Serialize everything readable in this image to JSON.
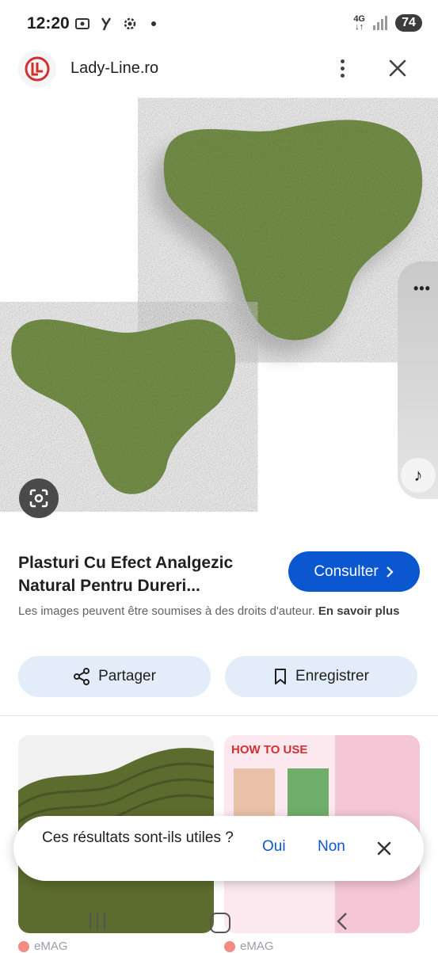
{
  "status_bar": {
    "time": "12:20",
    "network": "4G",
    "battery": "74",
    "icons": [
      "screenshot-icon",
      "y-app-icon",
      "settings-icon",
      "notification-dot-icon",
      "signal-icon"
    ]
  },
  "header": {
    "site_name": "Lady-Line.ro",
    "logo_icon": "lady-line-logo-icon",
    "menu_icon": "more-vert-icon",
    "close_icon": "close-icon"
  },
  "image": {
    "subject": "green-patch-product-image",
    "lens_icon": "google-lens-icon"
  },
  "edge_panel": {
    "dots_icon": "more-horiz-icon",
    "music_icon": "music-note-icon"
  },
  "result": {
    "title": "Plasturi Cu Efect Analgezic Natural Pentru Dureri...",
    "consult_label": "Consulter",
    "copyright_text": "Les images peuvent être soumises à des droits d'auteur.",
    "learn_more": "En savoir plus"
  },
  "actions": {
    "share_label": "Partager",
    "save_label": "Enregistrer"
  },
  "related": {
    "thumb2_banner": "HOW TO USE",
    "source1": "eMAG",
    "source2": "eMAG"
  },
  "feedback": {
    "question": "Ces résultats sont-ils utiles ?",
    "yes": "Oui",
    "no": "Non"
  },
  "colors": {
    "accent": "#0b57d0",
    "chip_bg": "#e3edf9",
    "product_green": "#7d9a4e"
  }
}
